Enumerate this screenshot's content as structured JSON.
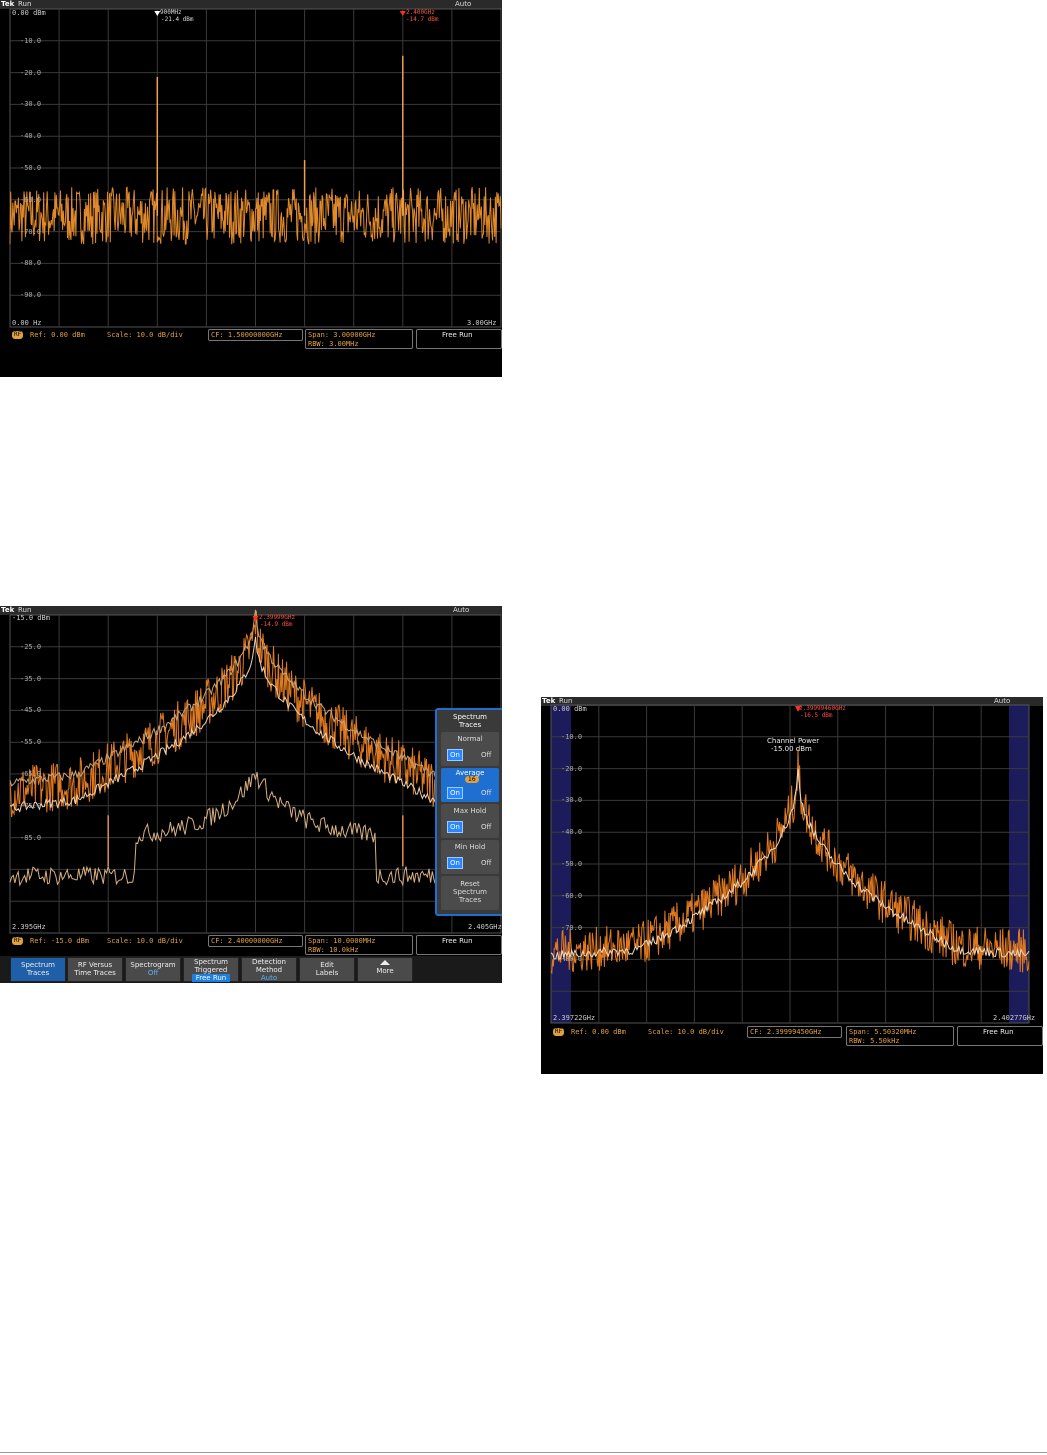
{
  "scope1": {
    "brand": "Tek",
    "state": "Run",
    "trigger": "Auto",
    "ref_level": "0.00 dBm",
    "y_ticks": [
      "-10.0",
      "-20.0",
      "-30.0",
      "-40.0",
      "-50.0",
      "-60.0",
      "-70.0",
      "-80.0",
      "-90.0"
    ],
    "x_start": "0.00 Hz",
    "x_end": "3.00GHz",
    "marker1_freq": "900MHz",
    "marker1_amp": "-21.4 dBm",
    "marker2_freq": "2.400GHz",
    "marker2_amp": "-14.7 dBm",
    "rf_badge": "RF",
    "ref": "Ref: 0.00 dBm",
    "scale": "Scale: 10.0 dB/div",
    "cf": "CF: 1.50000000GHz",
    "span": "Span:   3.00000GHz",
    "rbw": "RBW:   3.00MHz",
    "run_mode": "Free Run",
    "peaks": [
      {
        "freq_ghz": 0.9,
        "dbm": -21.4
      },
      {
        "freq_ghz": 1.8,
        "dbm": -47.5
      },
      {
        "freq_ghz": 2.4,
        "dbm": -14.7
      }
    ],
    "noise_floor_dbm": -65
  },
  "scope2": {
    "brand": "Tek",
    "state": "Run",
    "trigger": "Auto",
    "ref_level": "-15.0 dBm",
    "y_ticks": [
      "-25.0",
      "-35.0",
      "-45.0",
      "-55.0",
      "-65.0",
      "-75.0",
      "-85.0"
    ],
    "x_start": "2.395GHz",
    "x_end": "2.405GHz",
    "marker_freq": "2.39999GHz",
    "marker_amp": "-14.9 dBm",
    "rf_badge": "RF",
    "ref": "Ref: -15.0 dBm",
    "scale": "Scale: 10.0 dB/div",
    "cf": "CF: 2.40000000GHz",
    "span": "Span:   10.0000MHz",
    "rbw": "RBW:   10.0kHz",
    "run_mode": "Free Run",
    "panel": {
      "title_line1": "Spectrum",
      "title_line2": "Traces",
      "normal": "Normal",
      "average": "Average",
      "average_count": "16",
      "max_hold": "Max Hold",
      "min_hold": "Min Hold",
      "on": "On",
      "off": "Off",
      "reset_line1": "Reset",
      "reset_line2": "Spectrum",
      "reset_line3": "Traces"
    },
    "bottom_buttons": [
      {
        "line1": "Spectrum",
        "line2": "Traces",
        "sub": ""
      },
      {
        "line1": "RF Versus",
        "line2": "Time Traces",
        "sub": ""
      },
      {
        "line1": "Spectrogram",
        "line2": "",
        "sub": "Off"
      },
      {
        "line1": "Spectrum",
        "line2": "Triggered",
        "sub": "Free Run"
      },
      {
        "line1": "Detection",
        "line2": "Method",
        "sub": "Auto"
      },
      {
        "line1": "Edit",
        "line2": "Labels",
        "sub": ""
      },
      {
        "line1": "More",
        "line2": "",
        "sub": ""
      }
    ]
  },
  "scope3": {
    "brand": "Tek",
    "state": "Run",
    "trigger": "Auto",
    "ref_level": "0.00 dBm",
    "y_ticks": [
      "-10.0",
      "-20.0",
      "-30.0",
      "-40.0",
      "-50.0",
      "-60.0",
      "-70.0",
      "-80.0"
    ],
    "x_start": "2.39722GHz",
    "x_end": "2.40277GHz",
    "marker_freq": "2.39999460GHz",
    "marker_amp": "-16.5 dBm",
    "channel_power_label": "Channel Power",
    "channel_power_value": "-15.00 dBm",
    "rf_badge": "RF",
    "ref": "Ref: 0.00 dBm",
    "scale": "Scale: 10.0 dB/div",
    "cf": "CF: 2.39999450GHz",
    "span": "Span:   5.50320MHz",
    "rbw": "RBW:   5.50kHz",
    "run_mode": "Free Run"
  }
}
